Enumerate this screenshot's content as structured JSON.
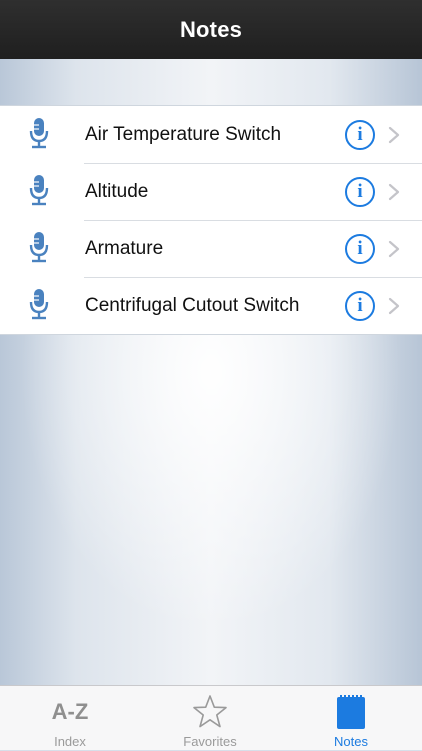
{
  "header": {
    "title": "Notes"
  },
  "notes": [
    {
      "label": "Air Temperature Switch",
      "icon": "microphone-icon"
    },
    {
      "label": "Altitude",
      "icon": "microphone-icon"
    },
    {
      "label": "Armature",
      "icon": "microphone-icon"
    },
    {
      "label": "Centrifugal Cutout Switch",
      "icon": "microphone-icon"
    }
  ],
  "row_actions": {
    "info_glyph": "i",
    "info_icon": "info-circle-icon",
    "chevron_icon": "chevron-right-icon"
  },
  "tabs": [
    {
      "label": "Index",
      "icon_text": "A-Z",
      "icon": "a-z-icon",
      "active": false
    },
    {
      "label": "Favorites",
      "icon": "star-icon",
      "active": false
    },
    {
      "label": "Notes",
      "icon": "notepad-icon",
      "active": true
    }
  ],
  "colors": {
    "accent": "#1c7be0",
    "mic": "#4a82bf",
    "nav_bar": "#262626",
    "tab_inactive": "#9a9a9a"
  }
}
